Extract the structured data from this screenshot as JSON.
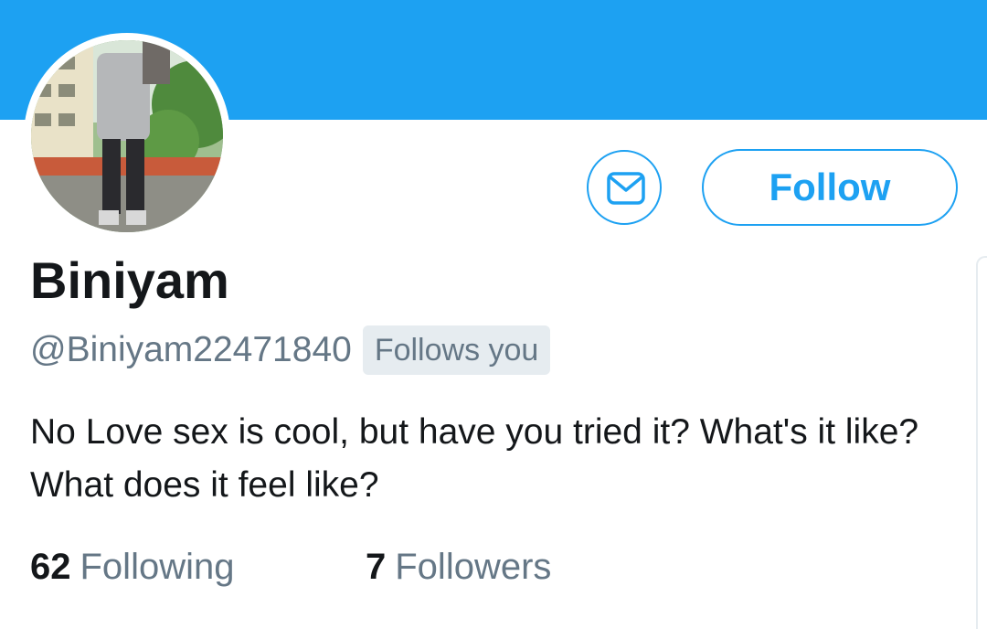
{
  "colors": {
    "accent": "#1da1f2",
    "text_primary": "#14171a",
    "text_secondary": "#657786",
    "badge_background": "#e6ecf0"
  },
  "header": {
    "banner_color": "#1da1f2"
  },
  "profile": {
    "avatar_icon": "profile-photo",
    "display_name": "Biniyam",
    "handle": "@Biniyam22471840",
    "follows_you_badge": "Follows you",
    "bio": "No Love sex is cool, but have you tried it? What's it like? What does it feel like?"
  },
  "actions": {
    "message_icon": "envelope-icon",
    "follow_label": "Follow"
  },
  "stats": {
    "following_count": "62",
    "following_label": "Following",
    "followers_count": "7",
    "followers_label": "Followers"
  }
}
